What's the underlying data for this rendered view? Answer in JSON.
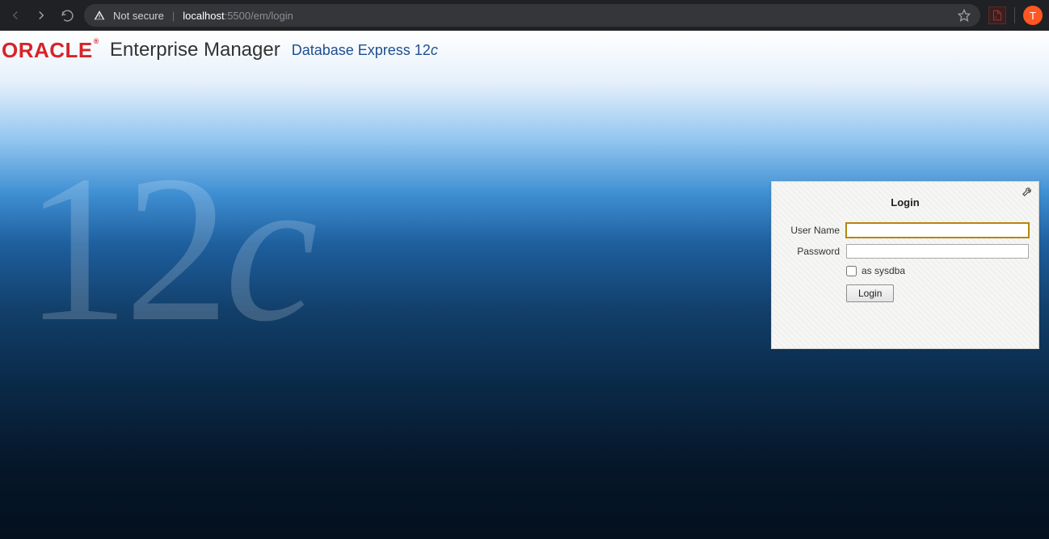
{
  "browser": {
    "not_secure_label": "Not secure",
    "url_host": "localhost",
    "url_rest": ":5500/em/login",
    "profile_initial": "T"
  },
  "header": {
    "logo_text": "ORACLE",
    "title_main": "Enterprise Manager",
    "title_sub_prefix": "Database Express 12",
    "title_sub_suffix": "c"
  },
  "watermark": {
    "prefix": "12",
    "suffix": "c"
  },
  "login": {
    "title": "Login",
    "username_label": "User Name",
    "password_label": "Password",
    "sysdba_label": "as sysdba",
    "login_button": "Login",
    "username_value": "",
    "password_value": ""
  }
}
